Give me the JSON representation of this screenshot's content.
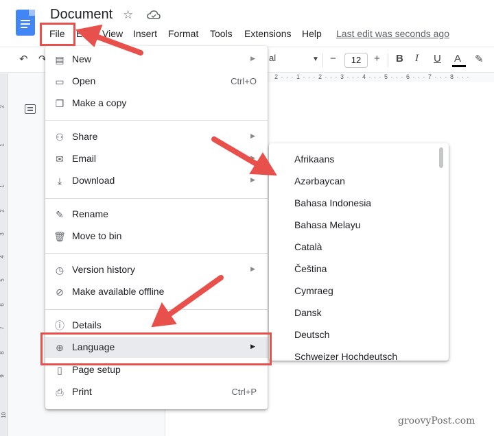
{
  "header": {
    "title": "Document",
    "last_edit": "Last edit was seconds ago",
    "icons": [
      "docs-logo-icon",
      "star-icon",
      "cloud-status-icon"
    ]
  },
  "menubar": [
    "File",
    "Edit",
    "View",
    "Insert",
    "Format",
    "Tools",
    "Extensions",
    "Help"
  ],
  "toolbar": {
    "font_name": "al",
    "font_size": "12",
    "minus": "−",
    "plus": "+",
    "bold": "B",
    "italic": "I",
    "underline": "U",
    "text_color": "A",
    "ruler_numbers": "2 · · · 1 · · · 2 · · · 3 · · · 4 · · · 5 · · · 6 · · · 7 · · · 8 · · ·"
  },
  "vruler_numbers": [
    "2",
    "1",
    "1",
    "2",
    "3",
    "4",
    "5",
    "6",
    "7",
    "8",
    "9",
    "10"
  ],
  "file_menu": {
    "items": [
      {
        "label": "New",
        "icon": "document-icon",
        "submenu": true
      },
      {
        "label": "Open",
        "icon": "folder-icon",
        "shortcut": "Ctrl+O"
      },
      {
        "label": "Make a copy",
        "icon": "copy-icon"
      },
      {
        "label": "Share",
        "icon": "person-add-icon",
        "submenu": true
      },
      {
        "label": "Email",
        "icon": "mail-icon",
        "submenu": true
      },
      {
        "label": "Download",
        "icon": "download-icon",
        "submenu": true
      },
      {
        "label": "Rename",
        "icon": "pencil-icon"
      },
      {
        "label": "Move to bin",
        "icon": "trash-icon"
      },
      {
        "label": "Version history",
        "icon": "history-icon",
        "submenu": true
      },
      {
        "label": "Make available offline",
        "icon": "offline-check-icon"
      },
      {
        "label": "Details",
        "icon": "info-icon"
      },
      {
        "label": "Language",
        "icon": "globe-icon",
        "submenu": true,
        "highlighted": true
      },
      {
        "label": "Page setup",
        "icon": "page-setup-icon"
      },
      {
        "label": "Print",
        "icon": "printer-icon",
        "shortcut": "Ctrl+P"
      }
    ]
  },
  "language_menu": {
    "items": [
      "Afrikaans",
      "Azərbaycan",
      "Bahasa Indonesia",
      "Bahasa Melayu",
      "Català",
      "Čeština",
      "Cymraeg",
      "Dansk",
      "Deutsch",
      "Schweizer Hochdeutsch"
    ]
  },
  "watermark": "groovyPost.com",
  "colors": {
    "accent": "#e8504b",
    "docs_blue": "#4285f4",
    "highlight_row": "#e8eaed"
  }
}
